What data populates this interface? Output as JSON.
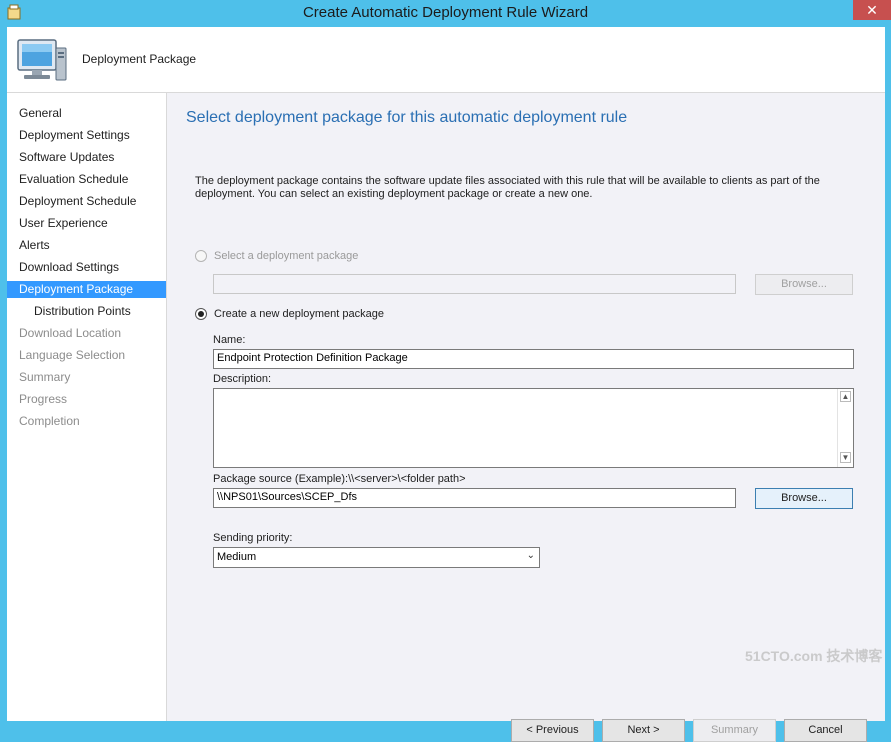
{
  "window": {
    "title": "Create Automatic Deployment Rule Wizard",
    "close_glyph": "✕"
  },
  "header": {
    "title": "Deployment Package",
    "icon": "computer-monitor-icon"
  },
  "nav": {
    "items": [
      {
        "label": "General",
        "state": "normal"
      },
      {
        "label": "Deployment Settings",
        "state": "normal"
      },
      {
        "label": "Software Updates",
        "state": "normal"
      },
      {
        "label": "Evaluation Schedule",
        "state": "normal"
      },
      {
        "label": "Deployment Schedule",
        "state": "normal"
      },
      {
        "label": "User Experience",
        "state": "normal"
      },
      {
        "label": "Alerts",
        "state": "normal"
      },
      {
        "label": "Download Settings",
        "state": "normal"
      },
      {
        "label": "Deployment Package",
        "state": "selected"
      },
      {
        "label": "Distribution Points",
        "state": "normal"
      },
      {
        "label": "Download Location",
        "state": "disabled"
      },
      {
        "label": "Language Selection",
        "state": "disabled"
      },
      {
        "label": "Summary",
        "state": "disabled"
      },
      {
        "label": "Progress",
        "state": "disabled"
      },
      {
        "label": "Completion",
        "state": "disabled"
      }
    ]
  },
  "main": {
    "heading": "Select deployment package for this automatic deployment rule",
    "description": "The deployment package contains the software update files associated with this rule that will be available to clients as part of the deployment. You can select an existing deployment package or create a new one.",
    "option_existing_label": "Select a deployment package",
    "existing_browse_label": "Browse...",
    "option_new_label": "Create a new deployment package",
    "name_label": "Name:",
    "name_value": "Endpoint Protection Definition Package",
    "description_label": "Description:",
    "description_value": "",
    "package_source_label": "Package source (Example):\\\\<server>\\<folder path>",
    "package_source_value": "\\\\NPS01\\Sources\\SCEP_Dfs",
    "source_browse_label": "Browse...",
    "sending_priority_label": "Sending priority:",
    "sending_priority_value": "Medium"
  },
  "footer": {
    "previous_label": "< Previous",
    "next_label": "Next >",
    "summary_label": "Summary",
    "cancel_label": "Cancel"
  },
  "watermark": {
    "text": "51CTO.com 技术博客"
  },
  "colors": {
    "title_bar": "#4ec0ea",
    "selected_nav": "#3399ff",
    "heading": "#2a6fb3",
    "content_bg": "#f2f2f7",
    "close_button": "#c7504f"
  }
}
